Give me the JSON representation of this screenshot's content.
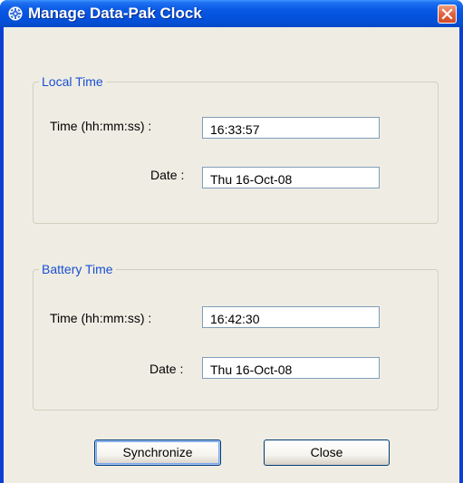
{
  "window": {
    "title": "Manage Data-Pak Clock",
    "icon": "gear-icon",
    "close_icon": "close-icon"
  },
  "local_time": {
    "legend": "Local Time",
    "time_label": "Time (hh:mm:ss) :",
    "time_value": "16:33:57",
    "date_label": "Date :",
    "date_value": "Thu 16-Oct-08"
  },
  "battery_time": {
    "legend": "Battery Time",
    "time_label": "Time (hh:mm:ss) :",
    "time_value": "16:42:30",
    "date_label": "Date :",
    "date_value": "Thu 16-Oct-08"
  },
  "buttons": {
    "synchronize_label": "Synchronize",
    "close_label": "Close"
  },
  "colors": {
    "title_bar": "#0553df",
    "legend_text": "#1a4fd4",
    "dialog_background": "#efede3",
    "close_button": "#e06845"
  }
}
